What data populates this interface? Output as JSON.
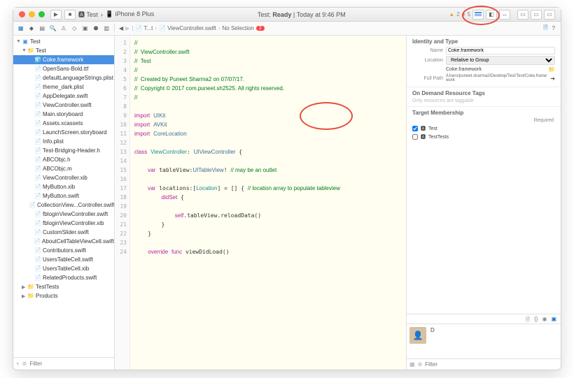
{
  "window": {
    "scheme": "Test",
    "device": "iPhone 8 Plus",
    "status_prefix": "Test:",
    "status": "Ready",
    "status_time": "Today at 9:46 PM",
    "warnings": "2",
    "errors": "5"
  },
  "breadcrumb": {
    "nav_back": "◀",
    "nav_fwd": "▶",
    "item1": "T...t",
    "item2": "ViewController.swift",
    "item3": "No Selection",
    "err_count": "2"
  },
  "navigator": {
    "root": "Test",
    "folder": "Test",
    "selected": "Coke.framework",
    "files": [
      "OpenSans-Bold.ttf",
      "defaultLanguageStrings.plist",
      "theme_dark.plist",
      "AppDelegate.swift",
      "ViewController.swift",
      "Main.storyboard",
      "Assets.xcassets",
      "LaunchScreen.storyboard",
      "Info.plist",
      "Test-Bridging-Header.h",
      "ABCObjc.h",
      "ABCObjc.m",
      "ViewController.xib",
      "MyButton.xib",
      "MyButton.swift",
      "CollectionView...Controller.swift",
      "fbloginViewController.swift",
      "fbloginViewController.xib",
      "CustomSlider.swift",
      "AboutCellTableViewCell.swift",
      "Contributors.swift",
      "UsersTableCell.swift",
      "UsersTableCell.xib",
      "RelatedProducts.swift"
    ],
    "folders_bottom": [
      "TestTests",
      "Products"
    ],
    "filter_placeholder": "Filter",
    "add": "+"
  },
  "editor": {
    "lines": [
      {
        "n": "1",
        "t": "comment",
        "s": "//"
      },
      {
        "n": "2",
        "t": "comment",
        "s": "//  ViewController.swift"
      },
      {
        "n": "3",
        "t": "comment",
        "s": "//  Test"
      },
      {
        "n": "4",
        "t": "comment",
        "s": "//"
      },
      {
        "n": "5",
        "t": "comment",
        "s": "//  Created by Puneet Sharma2 on 07/07/17."
      },
      {
        "n": "6",
        "t": "comment",
        "s": "//  Copyright © 2017 com.puneet.sh2525. All rights reserved."
      },
      {
        "n": "7",
        "t": "comment",
        "s": "//"
      },
      {
        "n": "8",
        "t": "plain",
        "s": ""
      },
      {
        "n": "9",
        "t": "import",
        "s": "import UIKit"
      },
      {
        "n": "10",
        "t": "import",
        "s": "import AVKit"
      },
      {
        "n": "11",
        "t": "import",
        "s": "import CoreLocation"
      },
      {
        "n": "12",
        "t": "plain",
        "s": ""
      },
      {
        "n": "13",
        "t": "class",
        "s": "class ViewController: UIViewController {"
      },
      {
        "n": "14",
        "t": "plain",
        "s": ""
      },
      {
        "n": "15",
        "t": "var",
        "s": "    var tableView:UITableView! // may be an outlet"
      },
      {
        "n": "16",
        "t": "plain",
        "s": ""
      },
      {
        "n": "17",
        "t": "var2",
        "s": "    var locations:[Location] = [] { // location array to populate tableview"
      },
      {
        "n": "18",
        "t": "didset",
        "s": "        didSet {"
      },
      {
        "n": "19",
        "t": "plain",
        "s": ""
      },
      {
        "n": "20",
        "t": "call",
        "s": "self.tableView.reloadData()"
      },
      {
        "n": "21",
        "t": "plain",
        "s": "        }"
      },
      {
        "n": "22",
        "t": "plain",
        "s": "    }"
      },
      {
        "n": "23",
        "t": "plain",
        "s": ""
      },
      {
        "n": "24",
        "t": "override",
        "s": "    override func viewDidLoad()"
      }
    ]
  },
  "inspector": {
    "identity_title": "Identity and Type",
    "name_label": "Name",
    "name_value": "Coke.framework",
    "location_label": "Location",
    "location_value": "Relative to Group",
    "location_file": "Coke.framework",
    "fullpath_label": "Full Path",
    "fullpath_value": "/Users/puneet.sharma2/Desktop/Test/Test/Coke.framework",
    "ondemand_title": "On Demand Resource Tags",
    "ondemand_hint": "Only resources are taggable",
    "target_title": "Target Membership",
    "target_required": "Required",
    "targets": [
      {
        "name": "Test",
        "checked": true
      },
      {
        "name": "TestTests",
        "checked": false
      }
    ],
    "author_initial": "D",
    "filter_placeholder": "Filter"
  }
}
